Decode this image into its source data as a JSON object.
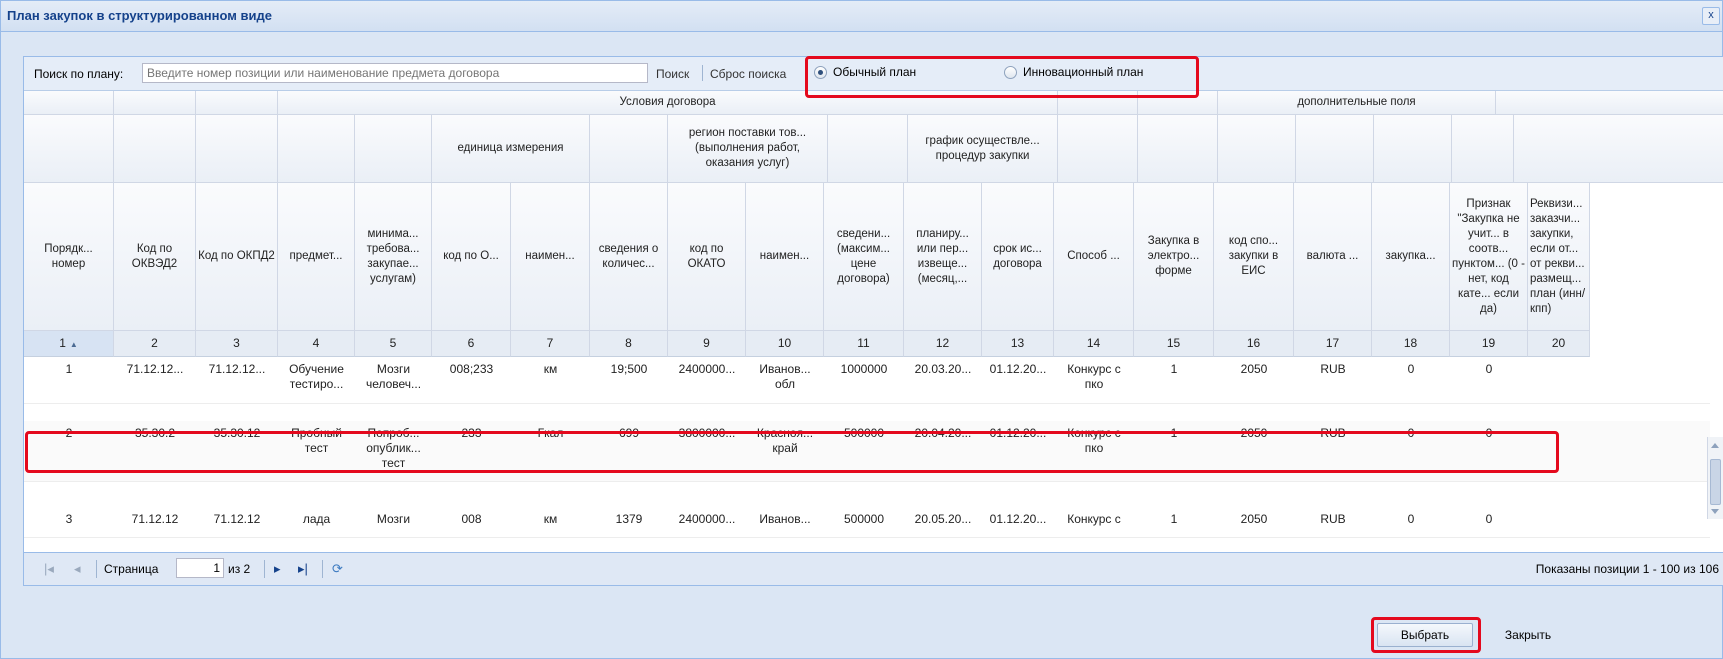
{
  "window": {
    "title": "План закупок в структурированном виде",
    "close_glyph": "x"
  },
  "search": {
    "label": "Поиск по плану:",
    "placeholder": "Введите номер позиции или наименование предмета договора",
    "search_btn": "Поиск",
    "reset_btn": "Сброс поиска",
    "radio_normal": "Обычный план",
    "radio_innov": "Инновационный план",
    "selected": "Обычный план"
  },
  "groups": {
    "contract_terms": "Условия договора",
    "extra_fields": "дополнительные поля",
    "unit": "единица измерения",
    "region": "регион поставки тов... (выполнения работ, оказания услуг)",
    "schedule": "график осуществле... процедур закупки"
  },
  "columns": [
    "Порядк... номер",
    "Код по ОКВЭД2",
    "Код по ОКПД2",
    "предмет...",
    "минима... требова... закупае... услугам)",
    "код по О...",
    "наимен...",
    "сведения о количес...",
    "код по ОКАТО",
    "наимен...",
    "сведени... (максим... цене договора)",
    "планиру... или пер... извеще... (месяц,...",
    "срок ис... договора",
    "Способ ...",
    "Закупка в электро... форме",
    "код спо... закупки в ЕИС",
    "валюта ...",
    "закупка...",
    "Признак \"Закупка не учит... в соотв... пунктом... (0 - нет, код кате... если да)",
    "Реквизи... заказчи... закупки, если от... от рекви... размещ... план (инн/кпп)"
  ],
  "column_numbers": [
    "1",
    "2",
    "3",
    "4",
    "5",
    "6",
    "7",
    "8",
    "9",
    "10",
    "11",
    "12",
    "13",
    "14",
    "15",
    "16",
    "17",
    "18",
    "19",
    "20"
  ],
  "sort_glyph": "▲",
  "rows": [
    {
      "line1": [
        "1",
        "71.12.12...",
        "71.12.12...",
        "Обучение",
        "Мозги",
        "008;233",
        "км",
        "19;500",
        "2400000...",
        "Иванов...",
        "1000000",
        "20.03.20...",
        "01.12.20...",
        "Конкурс с",
        "1",
        "2050",
        "RUB",
        "0",
        "0",
        ""
      ],
      "line2": [
        "",
        "",
        "",
        "тестиро...",
        "человеч...",
        "",
        "",
        "",
        "",
        "обл",
        "",
        "",
        "",
        "пко",
        "",
        "",
        "",
        "",
        "",
        ""
      ]
    },
    {
      "line1": [
        "2",
        "35.30.2",
        "35.30.12",
        "Пробный",
        "Попроб...",
        "233",
        "Гкал",
        "699",
        "3800000...",
        "Красноя...",
        "500000",
        "20.04.20...",
        "01.12.20...",
        "Конкурс с",
        "1",
        "2050",
        "RUB",
        "0",
        "0",
        ""
      ],
      "line2": [
        "",
        "",
        "",
        "тест",
        "опублик...",
        "",
        "",
        "",
        "",
        "край",
        "",
        "",
        "",
        "пко",
        "",
        "",
        "",
        "",
        "",
        ""
      ],
      "line3": [
        "",
        "",
        "",
        "",
        "тест",
        "",
        "",
        "",
        "",
        "",
        "",
        "",
        "",
        "",
        "",
        "",
        "",
        "",
        "",
        ""
      ]
    },
    {
      "line1": [
        "3",
        "71.12.12",
        "71.12.12",
        "лада",
        "Мозги",
        "008",
        "км",
        "1379",
        "2400000...",
        "Иванов...",
        "500000",
        "20.05.20...",
        "01.12.20...",
        "Конкурс с",
        "1",
        "2050",
        "RUB",
        "0",
        "0",
        ""
      ]
    }
  ],
  "pager": {
    "page_label": "Страница",
    "page_value": "1",
    "of_label": "из 2",
    "summary": "Показаны позиции 1 - 100 из 106"
  },
  "footer": {
    "select_btn": "Выбрать",
    "close_btn": "Закрыть"
  },
  "icons": {
    "first": "first-page-icon",
    "prev": "prev-page-icon",
    "next": "next-page-icon",
    "last": "last-page-icon",
    "refresh": "refresh-icon"
  },
  "colors": {
    "highlight": "#e4091d",
    "title": "#15428b"
  }
}
